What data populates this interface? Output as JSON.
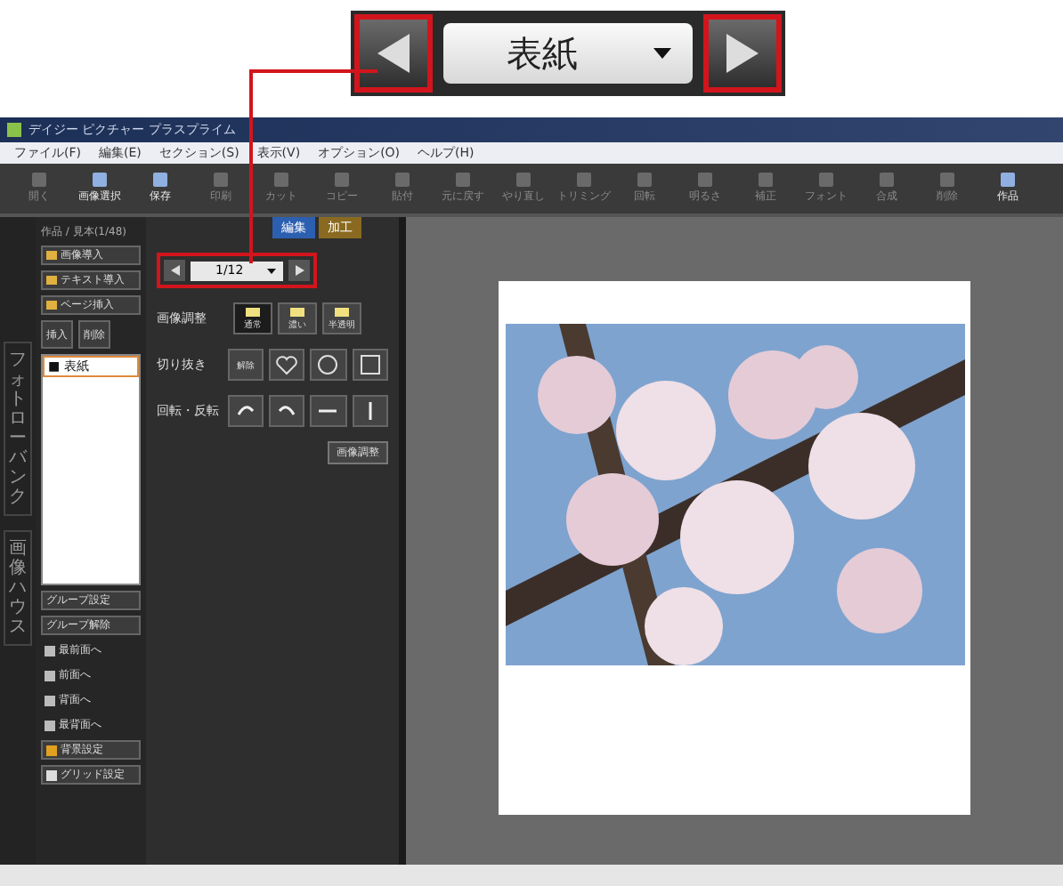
{
  "callout": {
    "page_label": "表紙"
  },
  "window": {
    "title": "デイジー ピクチャー プラスプライム"
  },
  "menu": [
    "ファイル(F)",
    "編集(E)",
    "セクション(S)",
    "表示(V)",
    "オプション(O)",
    "ヘルプ(H)"
  ],
  "toolbar": [
    {
      "label": "開く",
      "disabled": true
    },
    {
      "label": "画像選択",
      "disabled": false
    },
    {
      "label": "保存",
      "disabled": false
    },
    {
      "label": "印刷",
      "disabled": true
    },
    {
      "label": "カット",
      "disabled": true
    },
    {
      "label": "コピー",
      "disabled": true
    },
    {
      "label": "貼付",
      "disabled": true
    },
    {
      "label": "元に戻す",
      "disabled": true
    },
    {
      "label": "やり直し",
      "disabled": true
    },
    {
      "label": "トリミング",
      "disabled": true
    },
    {
      "label": "回転",
      "disabled": true
    },
    {
      "label": "明るさ",
      "disabled": true
    },
    {
      "label": "補正",
      "disabled": true
    },
    {
      "label": "フォント",
      "disabled": true
    },
    {
      "label": "合成",
      "disabled": true
    },
    {
      "label": "削除",
      "disabled": true
    },
    {
      "label": "作品",
      "disabled": false
    }
  ],
  "breadcrumb": "作品 / 見本(1/48)",
  "mode_tabs": [
    {
      "label": "編集",
      "selected": true
    },
    {
      "label": "加工",
      "selected": false
    }
  ],
  "side_tabs": [
    "フォトローバンク",
    "画像ハウス"
  ],
  "left_buttons": [
    "画像導入",
    "テキスト導入",
    "ページ挿入"
  ],
  "page_actions": [
    "挿入",
    "削除"
  ],
  "pages": [
    {
      "label": "■ 表紙",
      "selected": true
    }
  ],
  "order_buttons": [
    "グループ設定",
    "グループ解除"
  ],
  "arrange": [
    "最前面へ",
    "前面へ",
    "背面へ",
    "最背面へ"
  ],
  "bottom_buttons": [
    "背景設定",
    "グリッド設定"
  ],
  "nav": {
    "page": "1/12"
  },
  "adjust": {
    "label": "画像調整",
    "options": [
      {
        "label": "通常",
        "selected": true
      },
      {
        "label": "濃い",
        "selected": false
      },
      {
        "label": "半透明",
        "selected": false
      }
    ]
  },
  "crop": {
    "label": "切り抜き",
    "reset": "解除"
  },
  "rotate": {
    "label": "回転・反転"
  },
  "apply_button": "画像調整"
}
